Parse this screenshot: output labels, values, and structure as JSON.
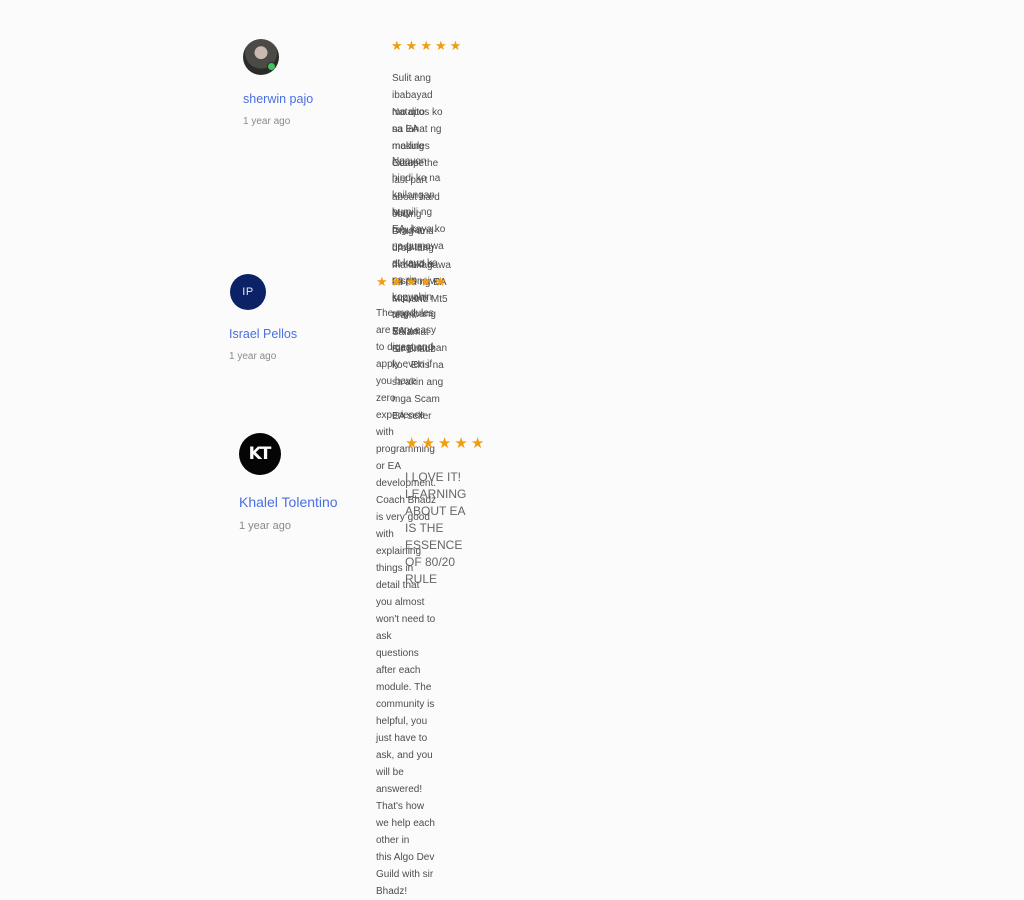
{
  "reviews": [
    {
      "reviewer": "sherwin pajo",
      "time": "1 year ago",
      "rating": 5,
      "avatar_icon": "profile-photo",
      "paragraphs": [
        "Sulit ang ibabayad mo dito sa EA making Course",
        "Natapos ko na lahat ng modules except the last part about hard coding\nDrag-and-drop lang makakagawa ka na ng EA Mt4 and Mt5",
        "Ngayon hindi ko na kailangan bumili ng EA, kaya ko na gumawa at kaya ko na rin\nkopyahin ang ibang EA na magustuhan ko . Ekis na sa akin ang mga Scam EA seller",
        "May regular updates din and a responsive support team.\nSalamat Sir Bhadz"
      ]
    },
    {
      "reviewer": "Israel Pellos",
      "time": "1 year ago",
      "rating": 5,
      "avatar_initials": "IP",
      "paragraphs": [
        "The modules are very easy to digest and apply even if you have zero experience with\nprogramming or EA development. Coach Bhadz is very good with explaining things in\ndetail that you almost won't need to ask questions after each module. The community is\nhelpful, you just have to ask, and you will be answered! That's how we help each other in\nthis Algo Dev Guild with sir Bhadz!"
      ]
    },
    {
      "reviewer": "Khalel Tolentino",
      "time": "1 year ago",
      "rating": 5,
      "avatar_initials": "KT",
      "paragraphs": [
        "I LOVE IT! LEARNING ABOUT EA IS THE ESSENCE OF 80/20 RULE"
      ]
    }
  ],
  "star_glyph": "★",
  "colors": {
    "star": "#f29d0c",
    "name": "#4a6fe0",
    "avatar_ip": "#0b2366"
  }
}
